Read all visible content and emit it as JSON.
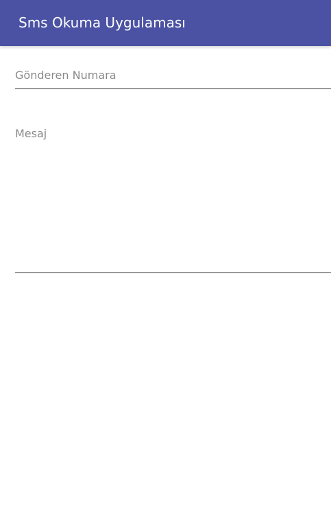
{
  "app_bar": {
    "title": "Sms Okuma Uygulaması",
    "color": "#4b52a3"
  },
  "form": {
    "sender_number": {
      "placeholder": "Gönderen Numara",
      "value": ""
    },
    "message": {
      "placeholder": "Mesaj",
      "value": ""
    }
  }
}
